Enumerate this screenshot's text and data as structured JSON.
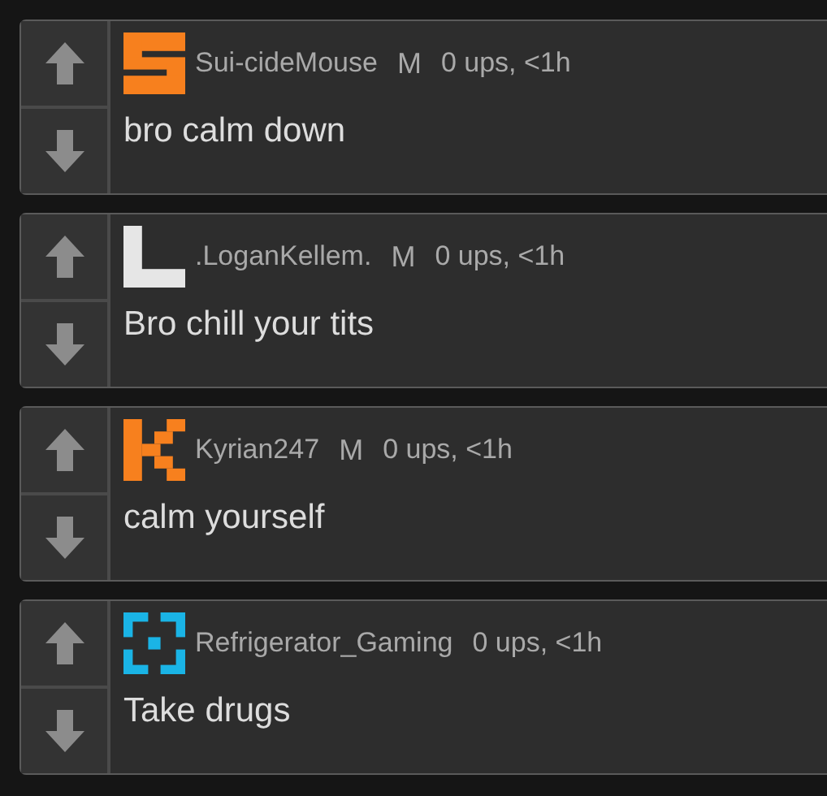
{
  "comments": [
    {
      "avatar": {
        "kind": "s-shape",
        "color": "#f7801e"
      },
      "username": "Sui-cideMouse",
      "badge": "M",
      "meta": "0 ups, <1h",
      "text": "bro calm down"
    },
    {
      "avatar": {
        "kind": "l-shape",
        "color": "#e6e6e6"
      },
      "username": ".LoganKellem.",
      "badge": "M",
      "meta": "0 ups, <1h",
      "text": "Bro chill your tits"
    },
    {
      "avatar": {
        "kind": "k-shape",
        "color": "#f7801e"
      },
      "username": "Kyrian247",
      "badge": "M",
      "meta": "0 ups, <1h",
      "text": "calm yourself"
    },
    {
      "avatar": {
        "kind": "frame",
        "color": "#1ab4e6"
      },
      "username": "Refrigerator_Gaming",
      "meta": "0 ups, <1h",
      "text": "Take drugs"
    }
  ]
}
